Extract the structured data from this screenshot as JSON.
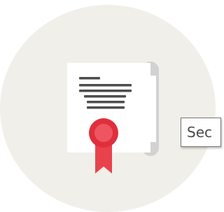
{
  "icon": {
    "name": "certificate-icon",
    "colors": {
      "background_circle": "#f1efe9",
      "paper": "#ffffff",
      "scroll_roll": "#c9c9c9",
      "text_lines": "#4d4d4d",
      "seal": "#e02f3c",
      "seal_inner": "#f26b72",
      "ribbon": "#e8434c"
    }
  },
  "tooltip": {
    "text": "Sec"
  }
}
